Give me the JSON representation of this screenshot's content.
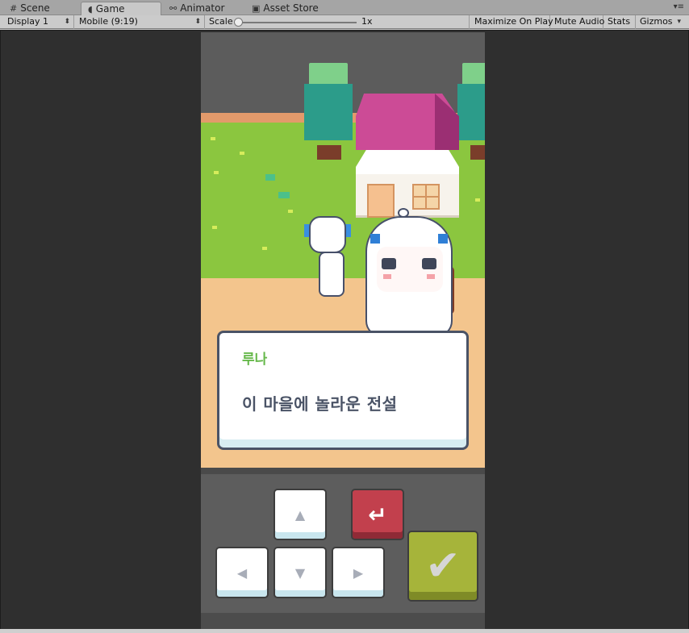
{
  "tabs": [
    {
      "label": "Scene",
      "icon": "grid-icon"
    },
    {
      "label": "Game",
      "icon": "pacman-icon",
      "active": true
    },
    {
      "label": "Animator",
      "icon": "animator-icon"
    },
    {
      "label": "Asset Store",
      "icon": "store-icon"
    }
  ],
  "toolbar": {
    "display": "Display 1",
    "resolution": "Mobile (9:19)",
    "scale_label": "Scale",
    "scale_value": "1x",
    "maximize": "Maximize On Play",
    "mute": "Mute Audio",
    "stats": "Stats",
    "gizmos": "Gizmos"
  },
  "dialog": {
    "speaker": "루나",
    "line": "이 마을에 놀라운 전설"
  },
  "controls": {
    "up": "▲",
    "down": "▼",
    "left": "◀",
    "right": "▶",
    "back": "↵",
    "confirm": "✔"
  },
  "colors": {
    "speaker": "#66b84a",
    "back_button": "#c2404d",
    "confirm_button": "#a6b43a",
    "grass": "#8bc63f",
    "ground": "#f3c58d",
    "roof": "#cc4b96"
  }
}
